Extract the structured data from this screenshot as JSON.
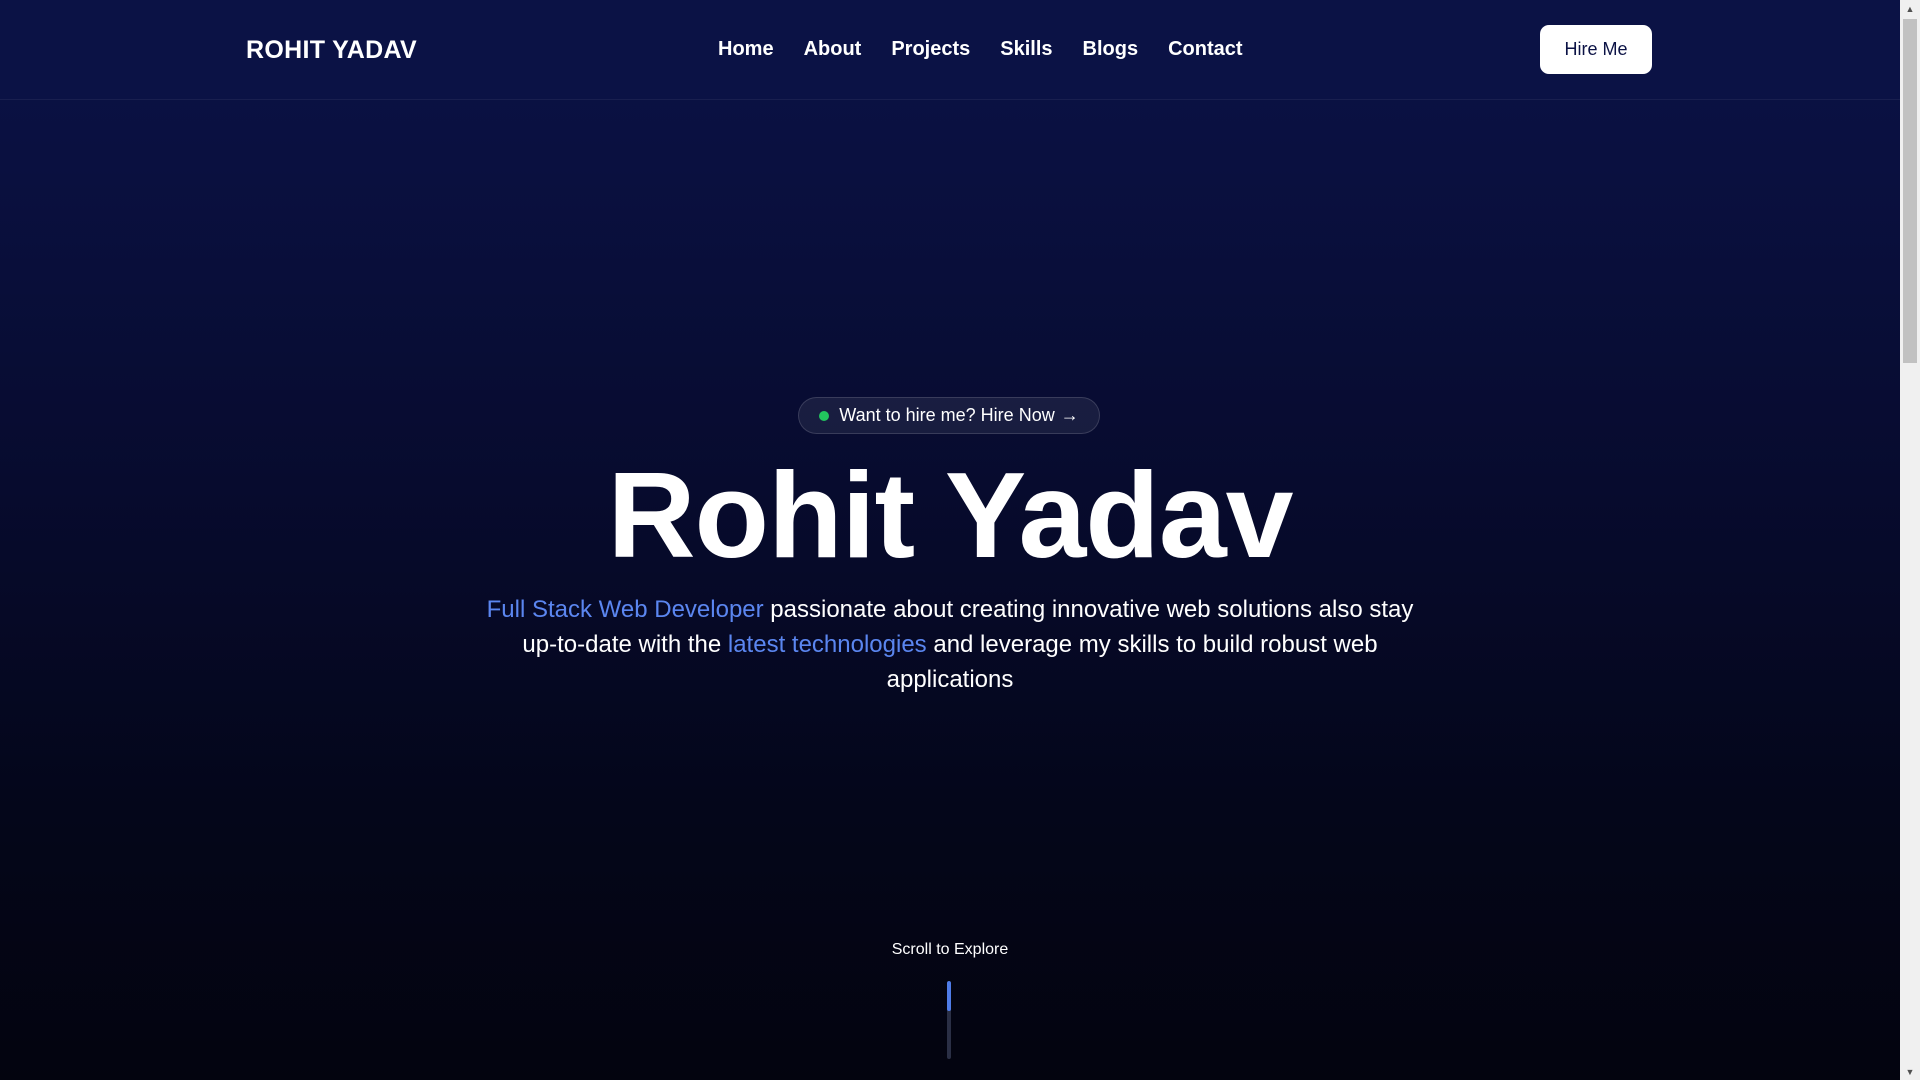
{
  "navbar": {
    "brand": "ROHIT YADAV",
    "links": [
      {
        "label": "Home"
      },
      {
        "label": "About"
      },
      {
        "label": "Projects"
      },
      {
        "label": "Skills"
      },
      {
        "label": "Blogs"
      },
      {
        "label": "Contact"
      }
    ],
    "cta_label": "Hire Me"
  },
  "hero": {
    "pill_text": "Want to hire me? Hire Now",
    "pill_arrow": "→",
    "pill_dot_color": "#22c55e",
    "title": "Rohit Yadav",
    "description": {
      "accent1": "Full Stack Web Developer",
      "text1": " passionate about creating innovative web solutions also stay up-to-date with the ",
      "accent2": "latest technologies",
      "text2": " and leverage my skills to build robust web applications"
    },
    "accent_color": "#5b86f0"
  },
  "scroll_indicator": {
    "label": "Scroll to Explore",
    "progress": 0.38
  },
  "browser_scrollbar": {
    "up_icon": "▲",
    "down_icon": "▼"
  },
  "colors": {
    "background_top": "#0b1245",
    "background_bottom": "#03040f",
    "button_bg": "#ffffff"
  }
}
